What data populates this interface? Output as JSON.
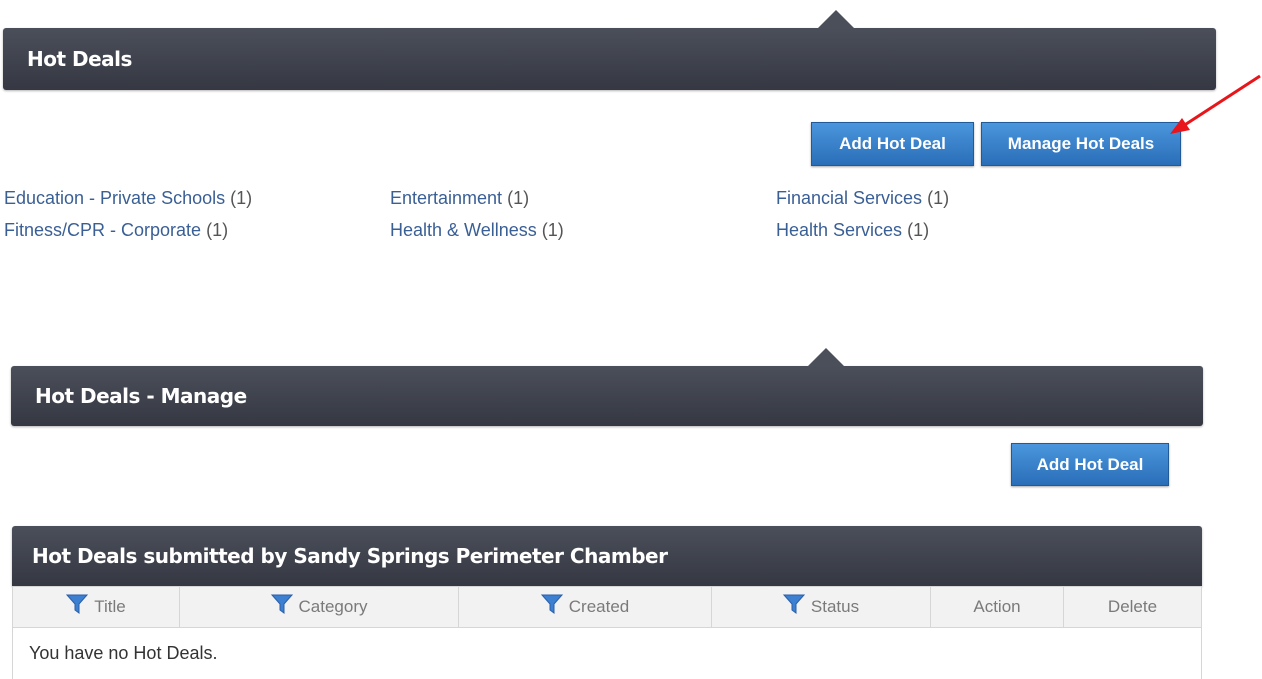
{
  "hot_deals": {
    "title": "Hot Deals",
    "add_button": "Add Hot Deal",
    "manage_button": "Manage Hot Deals",
    "categories": [
      {
        "name": "Education - Private Schools",
        "count": "(1)"
      },
      {
        "name": "Entertainment",
        "count": "(1)"
      },
      {
        "name": "Financial Services",
        "count": "(1)"
      },
      {
        "name": "Fitness/CPR - Corporate",
        "count": "(1)"
      },
      {
        "name": "Health & Wellness",
        "count": "(1)"
      },
      {
        "name": "Health Services",
        "count": "(1)"
      }
    ]
  },
  "manage": {
    "title": "Hot Deals - Manage",
    "add_button": "Add Hot Deal"
  },
  "submitted": {
    "title": "Hot Deals submitted by Sandy Springs Perimeter Chamber",
    "columns": [
      "Title",
      "Category",
      "Created",
      "Status",
      "Action",
      "Delete"
    ],
    "empty_message": "You have no Hot Deals."
  },
  "colors": {
    "bar": "#3f434d",
    "button": "#2f7cc8",
    "link": "#3a5f95",
    "annotation_arrow": "#e8151b"
  },
  "icons": {
    "filter": "funnel-icon",
    "annotation": "red-arrow"
  }
}
